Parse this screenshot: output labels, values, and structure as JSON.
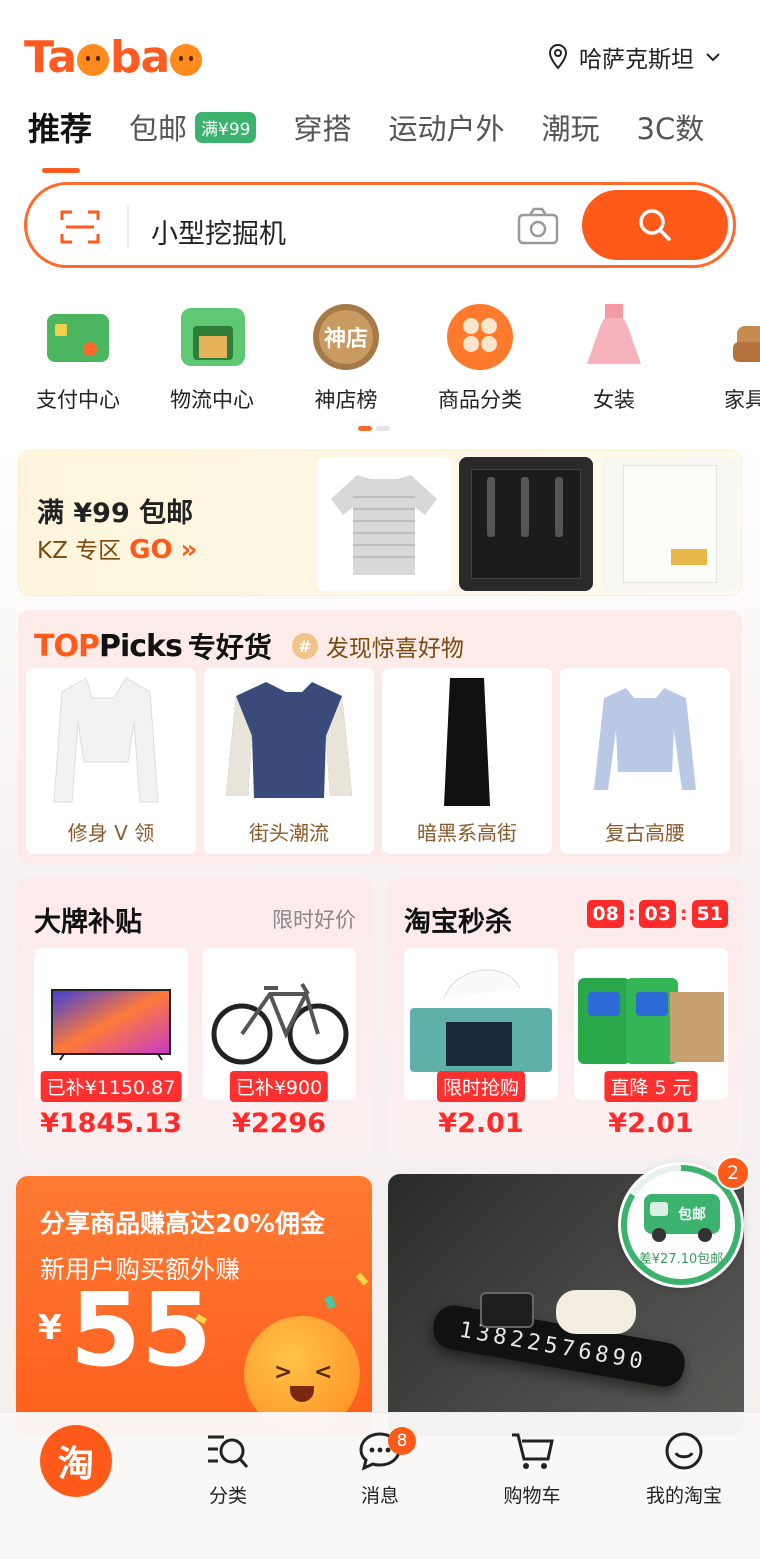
{
  "header": {
    "logo": "Taobao",
    "location": "哈萨克斯坦"
  },
  "tabs": [
    {
      "label": "推荐",
      "active": true
    },
    {
      "label": "包邮",
      "badge": "满¥99"
    },
    {
      "label": "穿搭"
    },
    {
      "label": "运动户外"
    },
    {
      "label": "潮玩"
    },
    {
      "label": "3C数"
    }
  ],
  "search": {
    "query": "小型挖掘机"
  },
  "quick_links": [
    "支付中心",
    "物流中心",
    "神店榜",
    "商品分类",
    "女装",
    "家具"
  ],
  "promo": {
    "title": "满 ¥99 包邮",
    "subtitle": "KZ 专区",
    "go": "GO"
  },
  "top_picks": {
    "top": "TOP",
    "picks": "Picks",
    "zhuan": "专好货",
    "tagline": "发现惊喜好物",
    "items": [
      "修身 V 领",
      "街头潮流",
      "暗黑系高街",
      "复古高腰"
    ]
  },
  "brand_subsidy": {
    "title": "大牌补贴",
    "hint": "限时好价",
    "products": [
      {
        "tag": "已补¥1150.87",
        "price": "¥1845.13"
      },
      {
        "tag": "已补¥900",
        "price": "¥2296"
      }
    ]
  },
  "flash_sale": {
    "title": "淘宝秒杀",
    "timer": [
      "08",
      "03",
      "51"
    ],
    "products": [
      {
        "tag": "限时抢购",
        "price": "¥2.01"
      },
      {
        "tag": "直降 5 元",
        "price": "¥2.01"
      }
    ]
  },
  "share_banner": {
    "line1": "分享商品赚高达20%佣金",
    "line2": "新用户购买额外赚",
    "currency": "¥",
    "amount": "55"
  },
  "plate_banner": {
    "number": "13822576890"
  },
  "free_shipping_widget": {
    "label": "包邮",
    "remaining": "差¥27.10包邮",
    "badge": "2"
  },
  "bottom_nav": [
    {
      "label": "淘",
      "icon": "home-icon"
    },
    {
      "label": "分类",
      "icon": "category-search-icon"
    },
    {
      "label": "消息",
      "icon": "message-icon",
      "badge": "8"
    },
    {
      "label": "购物车",
      "icon": "cart-icon"
    },
    {
      "label": "我的淘宝",
      "icon": "profile-icon"
    }
  ],
  "colors": {
    "brand": "#ff5a1a",
    "price_red": "#ff2a2a",
    "free_ship_green": "#3bb36e"
  }
}
